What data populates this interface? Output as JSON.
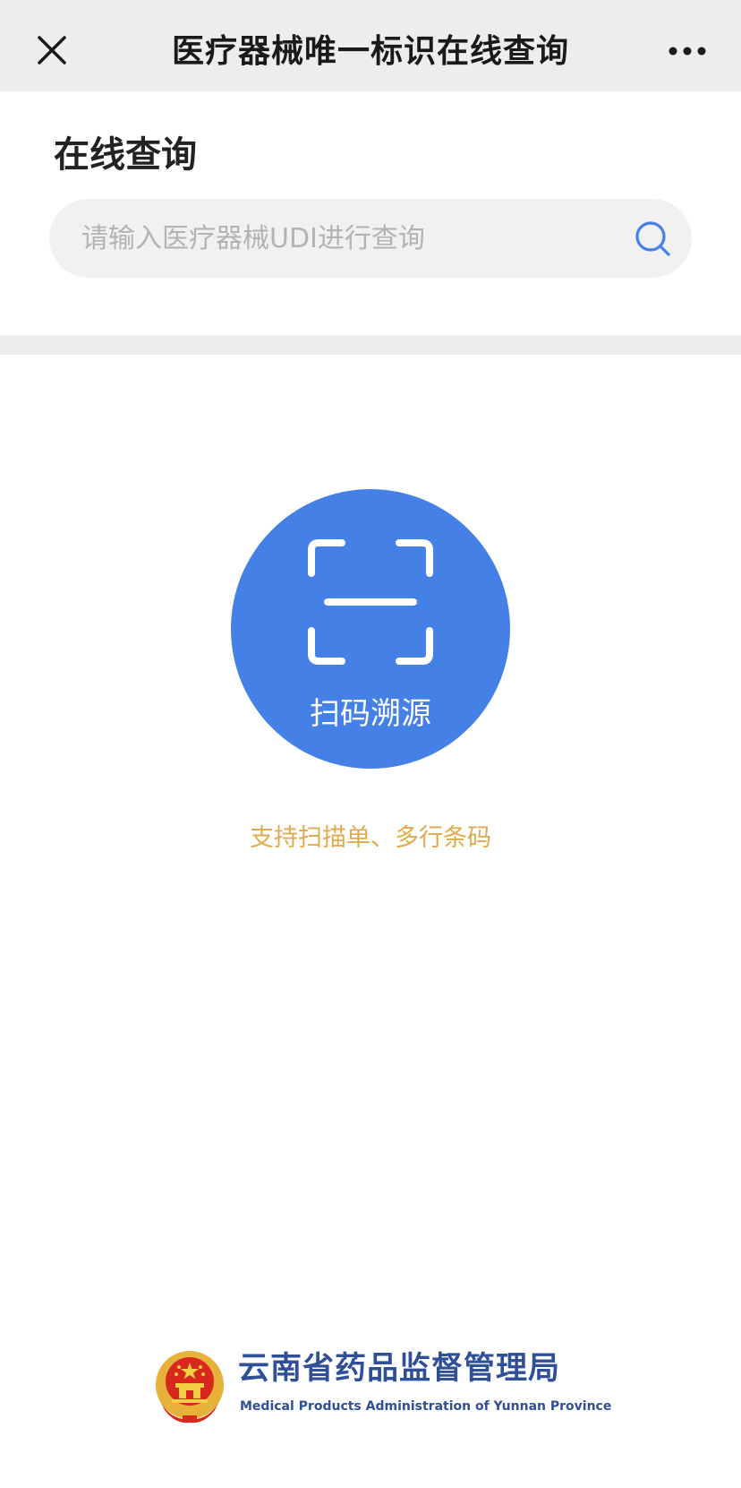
{
  "header": {
    "title": "医疗器械唯一标识在线查询",
    "close_icon": "close-icon",
    "more_icon": "more-horizontal-icon"
  },
  "query": {
    "section_title": "在线查询",
    "search_placeholder": "请输入医疗器械UDI进行查询",
    "search_value": "",
    "search_icon": "search-icon"
  },
  "scan": {
    "label": "扫码溯源",
    "icon": "scan-frame-icon",
    "hint": "支持扫描单、多行条码"
  },
  "footer": {
    "org_name": "云南省药品监督管理局",
    "org_name_en": "Medical Products Administration of Yunnan Province",
    "emblem": "national-emblem-icon"
  },
  "colors": {
    "nav_background": "#ededed",
    "accent_blue": "#4580e6",
    "hint_orange": "#e2aa4e",
    "org_blue": "#2f4f97"
  }
}
